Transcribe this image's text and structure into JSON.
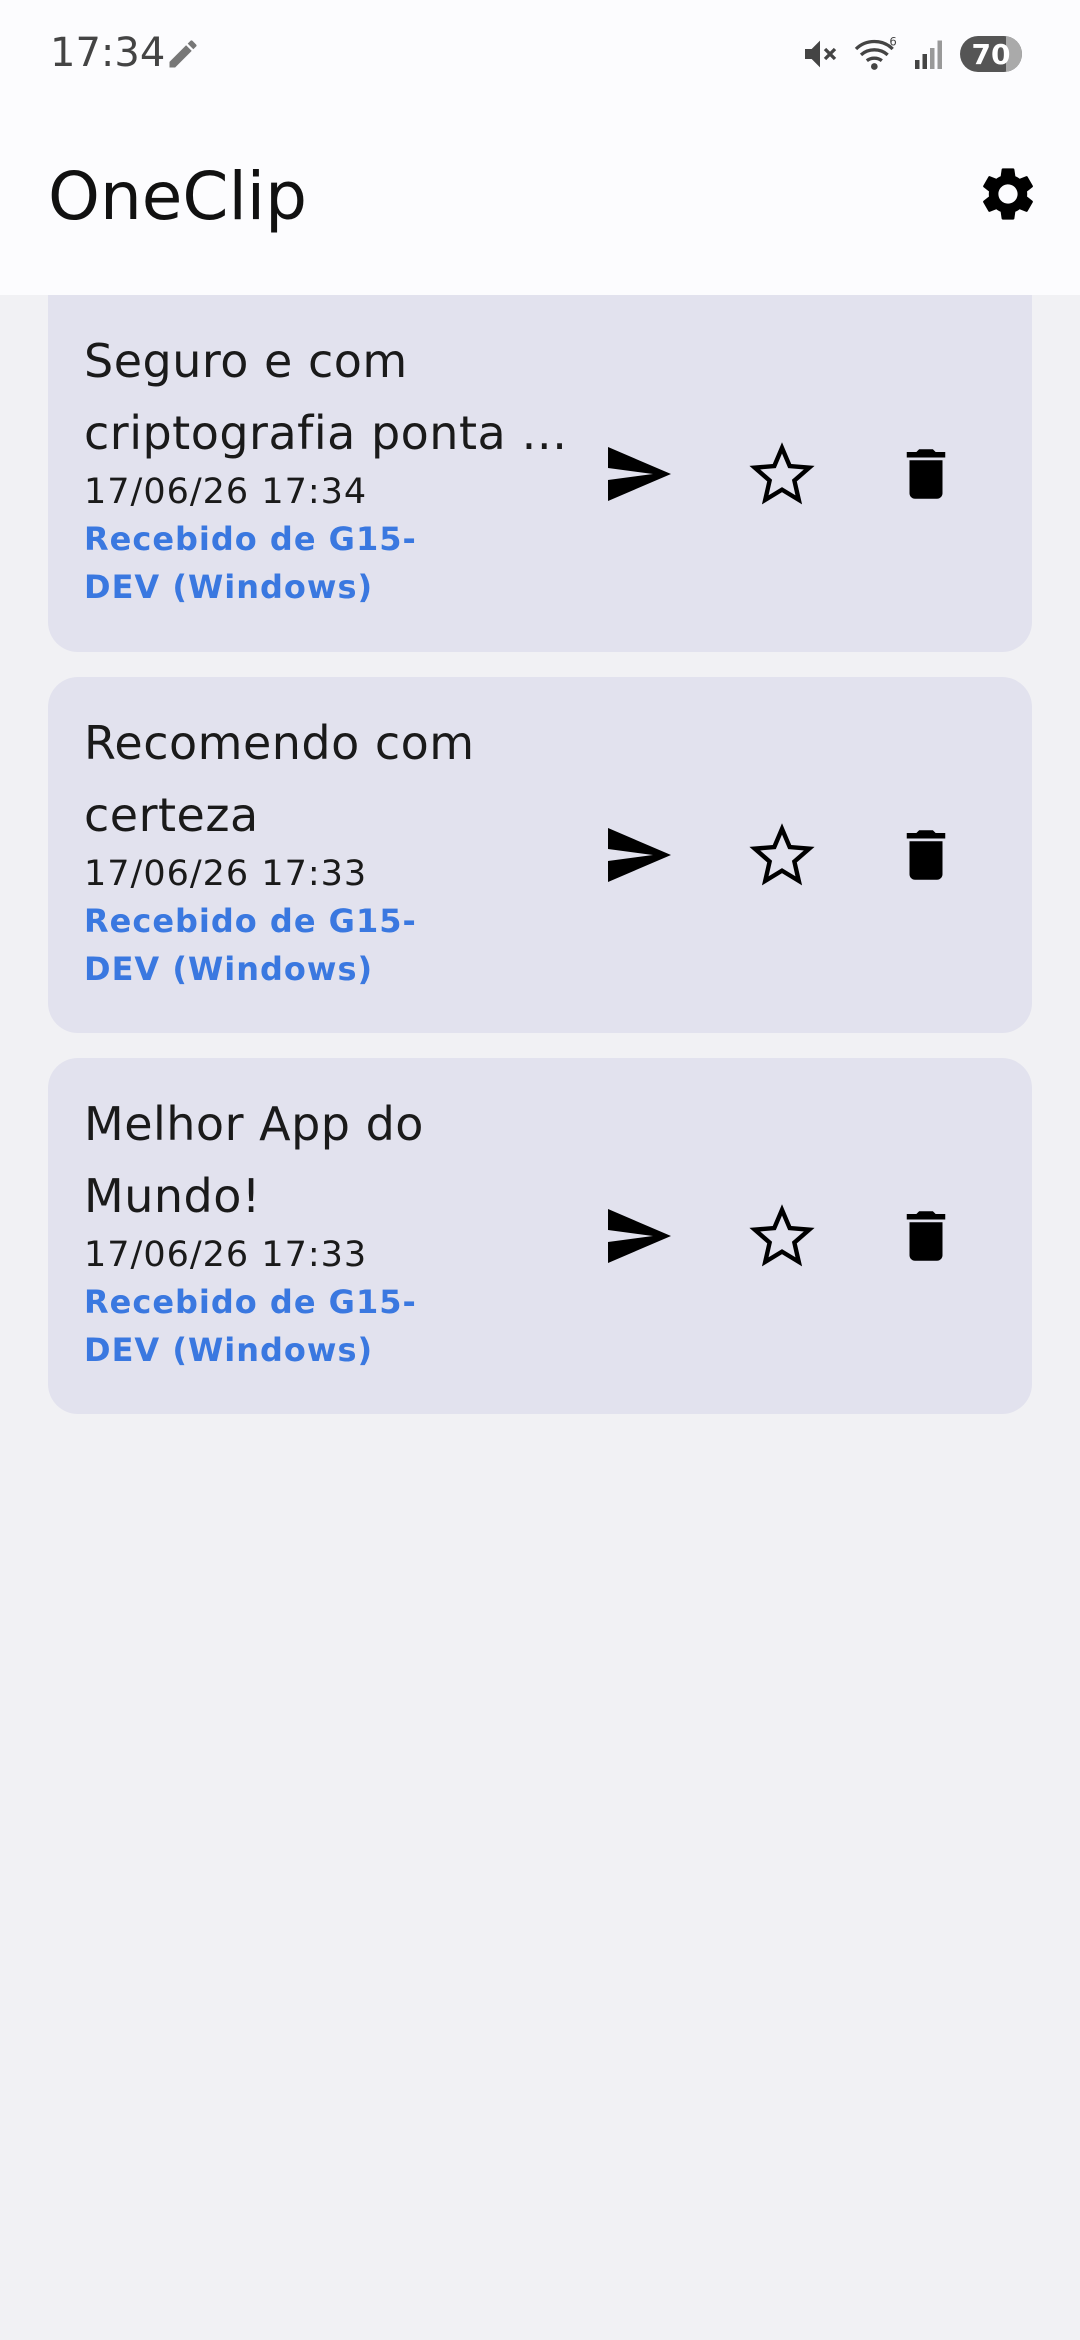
{
  "status_bar": {
    "time": "17:34",
    "battery": "70",
    "icons": [
      "pencil-icon",
      "mute-icon",
      "wifi-icon",
      "signal-icon",
      "battery-icon"
    ]
  },
  "app_bar": {
    "title": "OneClip",
    "settings_icon": "gear-icon"
  },
  "clips": [
    {
      "text": "Seguro e com criptografia ponta a ponta",
      "date": "17/06/26 17:34",
      "source": "Recebido de G15-DEV (Windows)"
    },
    {
      "text": "Recomendo com certeza",
      "date": "17/06/26 17:33",
      "source": "Recebido de G15-DEV (Windows)"
    },
    {
      "text": "Melhor App do Mundo!",
      "date": "17/06/26 17:33",
      "source": "Recebido de G15-DEV (Windows)"
    }
  ],
  "actions": [
    "send-icon",
    "star-outline-icon",
    "trash-icon"
  ]
}
